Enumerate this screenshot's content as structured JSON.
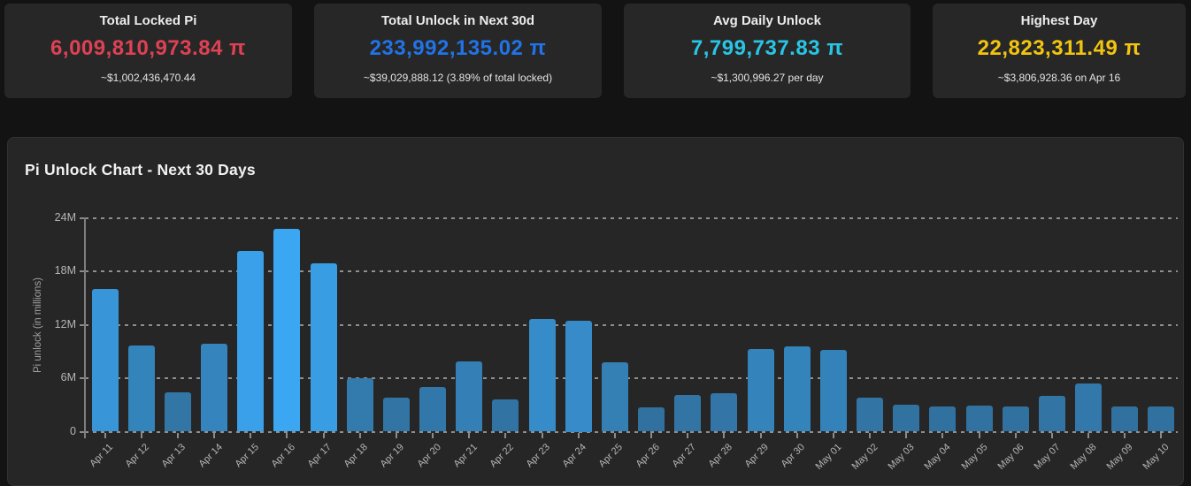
{
  "page": {
    "bg_color": "#131313",
    "card_bg_color": "#272727",
    "panel_bg_color": "#262626"
  },
  "cards": [
    {
      "title": "Total Locked Pi",
      "value": "6,009,810,973.84 π",
      "value_color": "#df4154",
      "subtitle": "~$1,002,436,470.44"
    },
    {
      "title": "Total Unlock in Next 30d",
      "value": "233,992,135.02 π",
      "value_color": "#2173e8",
      "subtitle": "~$39,029,888.12 (3.89% of total locked)"
    },
    {
      "title": "Avg Daily Unlock",
      "value": "7,799,737.83 π",
      "value_color": "#29c5e5",
      "subtitle": "~$1,300,996.27 per day"
    },
    {
      "title": "Highest Day",
      "value": "22,823,311.49 π",
      "value_color": "#f2c50f",
      "subtitle": "~$3,806,928.36 on Apr 16"
    }
  ],
  "chart_data": {
    "type": "bar",
    "title": "Pi Unlock Chart - Next 30 Days",
    "ylabel": "Pi unlock (in millions)",
    "xlabel": "",
    "unit": "millions of π",
    "ylim": [
      0,
      24
    ],
    "grid": "dashed horizontal, legend none",
    "yticks": [
      {
        "label": "24M",
        "value": 24
      },
      {
        "label": "18M",
        "value": 18
      },
      {
        "label": "12M",
        "value": 12
      },
      {
        "label": "6M",
        "value": 6
      },
      {
        "label": "0",
        "value": 0
      }
    ],
    "categories": [
      "Apr 11",
      "Apr 12",
      "Apr 13",
      "Apr 14",
      "Apr 15",
      "Apr 16",
      "Apr 17",
      "Apr 18",
      "Apr 19",
      "Apr 20",
      "Apr 21",
      "Apr 22",
      "Apr 23",
      "Apr 24",
      "Apr 25",
      "Apr 26",
      "Apr 27",
      "Apr 28",
      "Apr 29",
      "Apr 30",
      "May 01",
      "May 02",
      "May 03",
      "May 04",
      "May 05",
      "May 06",
      "May 07",
      "May 08",
      "May 09",
      "May 10"
    ],
    "values": [
      16.1,
      9.7,
      4.4,
      9.9,
      20.3,
      22.8,
      18.9,
      6.0,
      3.8,
      5.0,
      7.9,
      3.6,
      12.7,
      12.5,
      7.8,
      2.7,
      4.1,
      4.3,
      9.3,
      9.6,
      9.2,
      3.8,
      3.0,
      2.8,
      2.9,
      2.8,
      4.0,
      5.4,
      2.8,
      2.8
    ],
    "bar_color_low": "#31719f",
    "bar_color_high": "#3ba7f3"
  }
}
